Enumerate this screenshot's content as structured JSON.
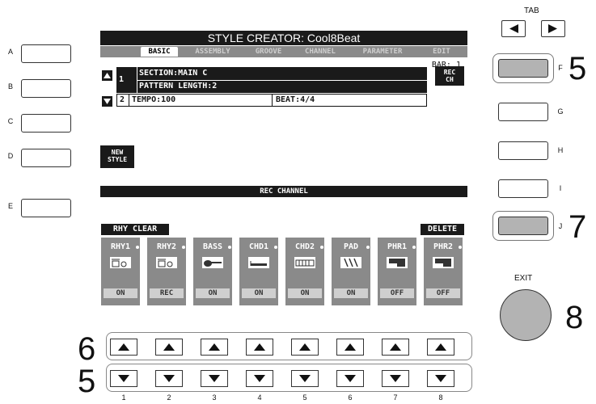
{
  "tab_nav": {
    "label": "TAB"
  },
  "screen": {
    "title": "STYLE CREATOR: Cool8Beat",
    "tabs": [
      "BASIC",
      "ASSEMBLY",
      "GROOVE",
      "CHANNEL",
      "PARAMETER",
      "EDIT"
    ],
    "active_tab": "BASIC",
    "bar": "BAR:  1",
    "row1_num": "1",
    "section": "SECTION:MAIN C",
    "pattern_length": "PATTERN LENGTH:2",
    "row2_num": "2",
    "tempo": "TEMPO:100",
    "beat": "BEAT:4/4",
    "rec_ch": [
      "REC",
      "CH"
    ],
    "new_style": [
      "NEW",
      "STYLE"
    ],
    "rec_channel_title": "REC CHANNEL",
    "rhy_clear": "RHY CLEAR",
    "delete": "DELETE",
    "channels": [
      {
        "name": "RHY1",
        "state": "ON",
        "icon": "drum-kit-icon"
      },
      {
        "name": "RHY2",
        "state": "REC",
        "icon": "drum-kit-icon"
      },
      {
        "name": "BASS",
        "state": "ON",
        "icon": "bass-guitar-icon"
      },
      {
        "name": "CHD1",
        "state": "ON",
        "icon": "guitar-icon"
      },
      {
        "name": "CHD2",
        "state": "ON",
        "icon": "keyboard-icon"
      },
      {
        "name": "PAD",
        "state": "ON",
        "icon": "strings-icon"
      },
      {
        "name": "PHR1",
        "state": "OFF",
        "icon": "piano-icon"
      },
      {
        "name": "PHR2",
        "state": "OFF",
        "icon": "piano-icon"
      }
    ]
  },
  "left_buttons": [
    "A",
    "B",
    "C",
    "D",
    "E"
  ],
  "right_buttons": [
    "F",
    "G",
    "H",
    "I",
    "J"
  ],
  "exit_label": "EXIT",
  "callouts": {
    "f": "5",
    "j": "7",
    "exit": "8",
    "upper_row": "6",
    "lower_row": "5"
  },
  "bottom_numbers": [
    "1",
    "2",
    "3",
    "4",
    "5",
    "6",
    "7",
    "8"
  ]
}
